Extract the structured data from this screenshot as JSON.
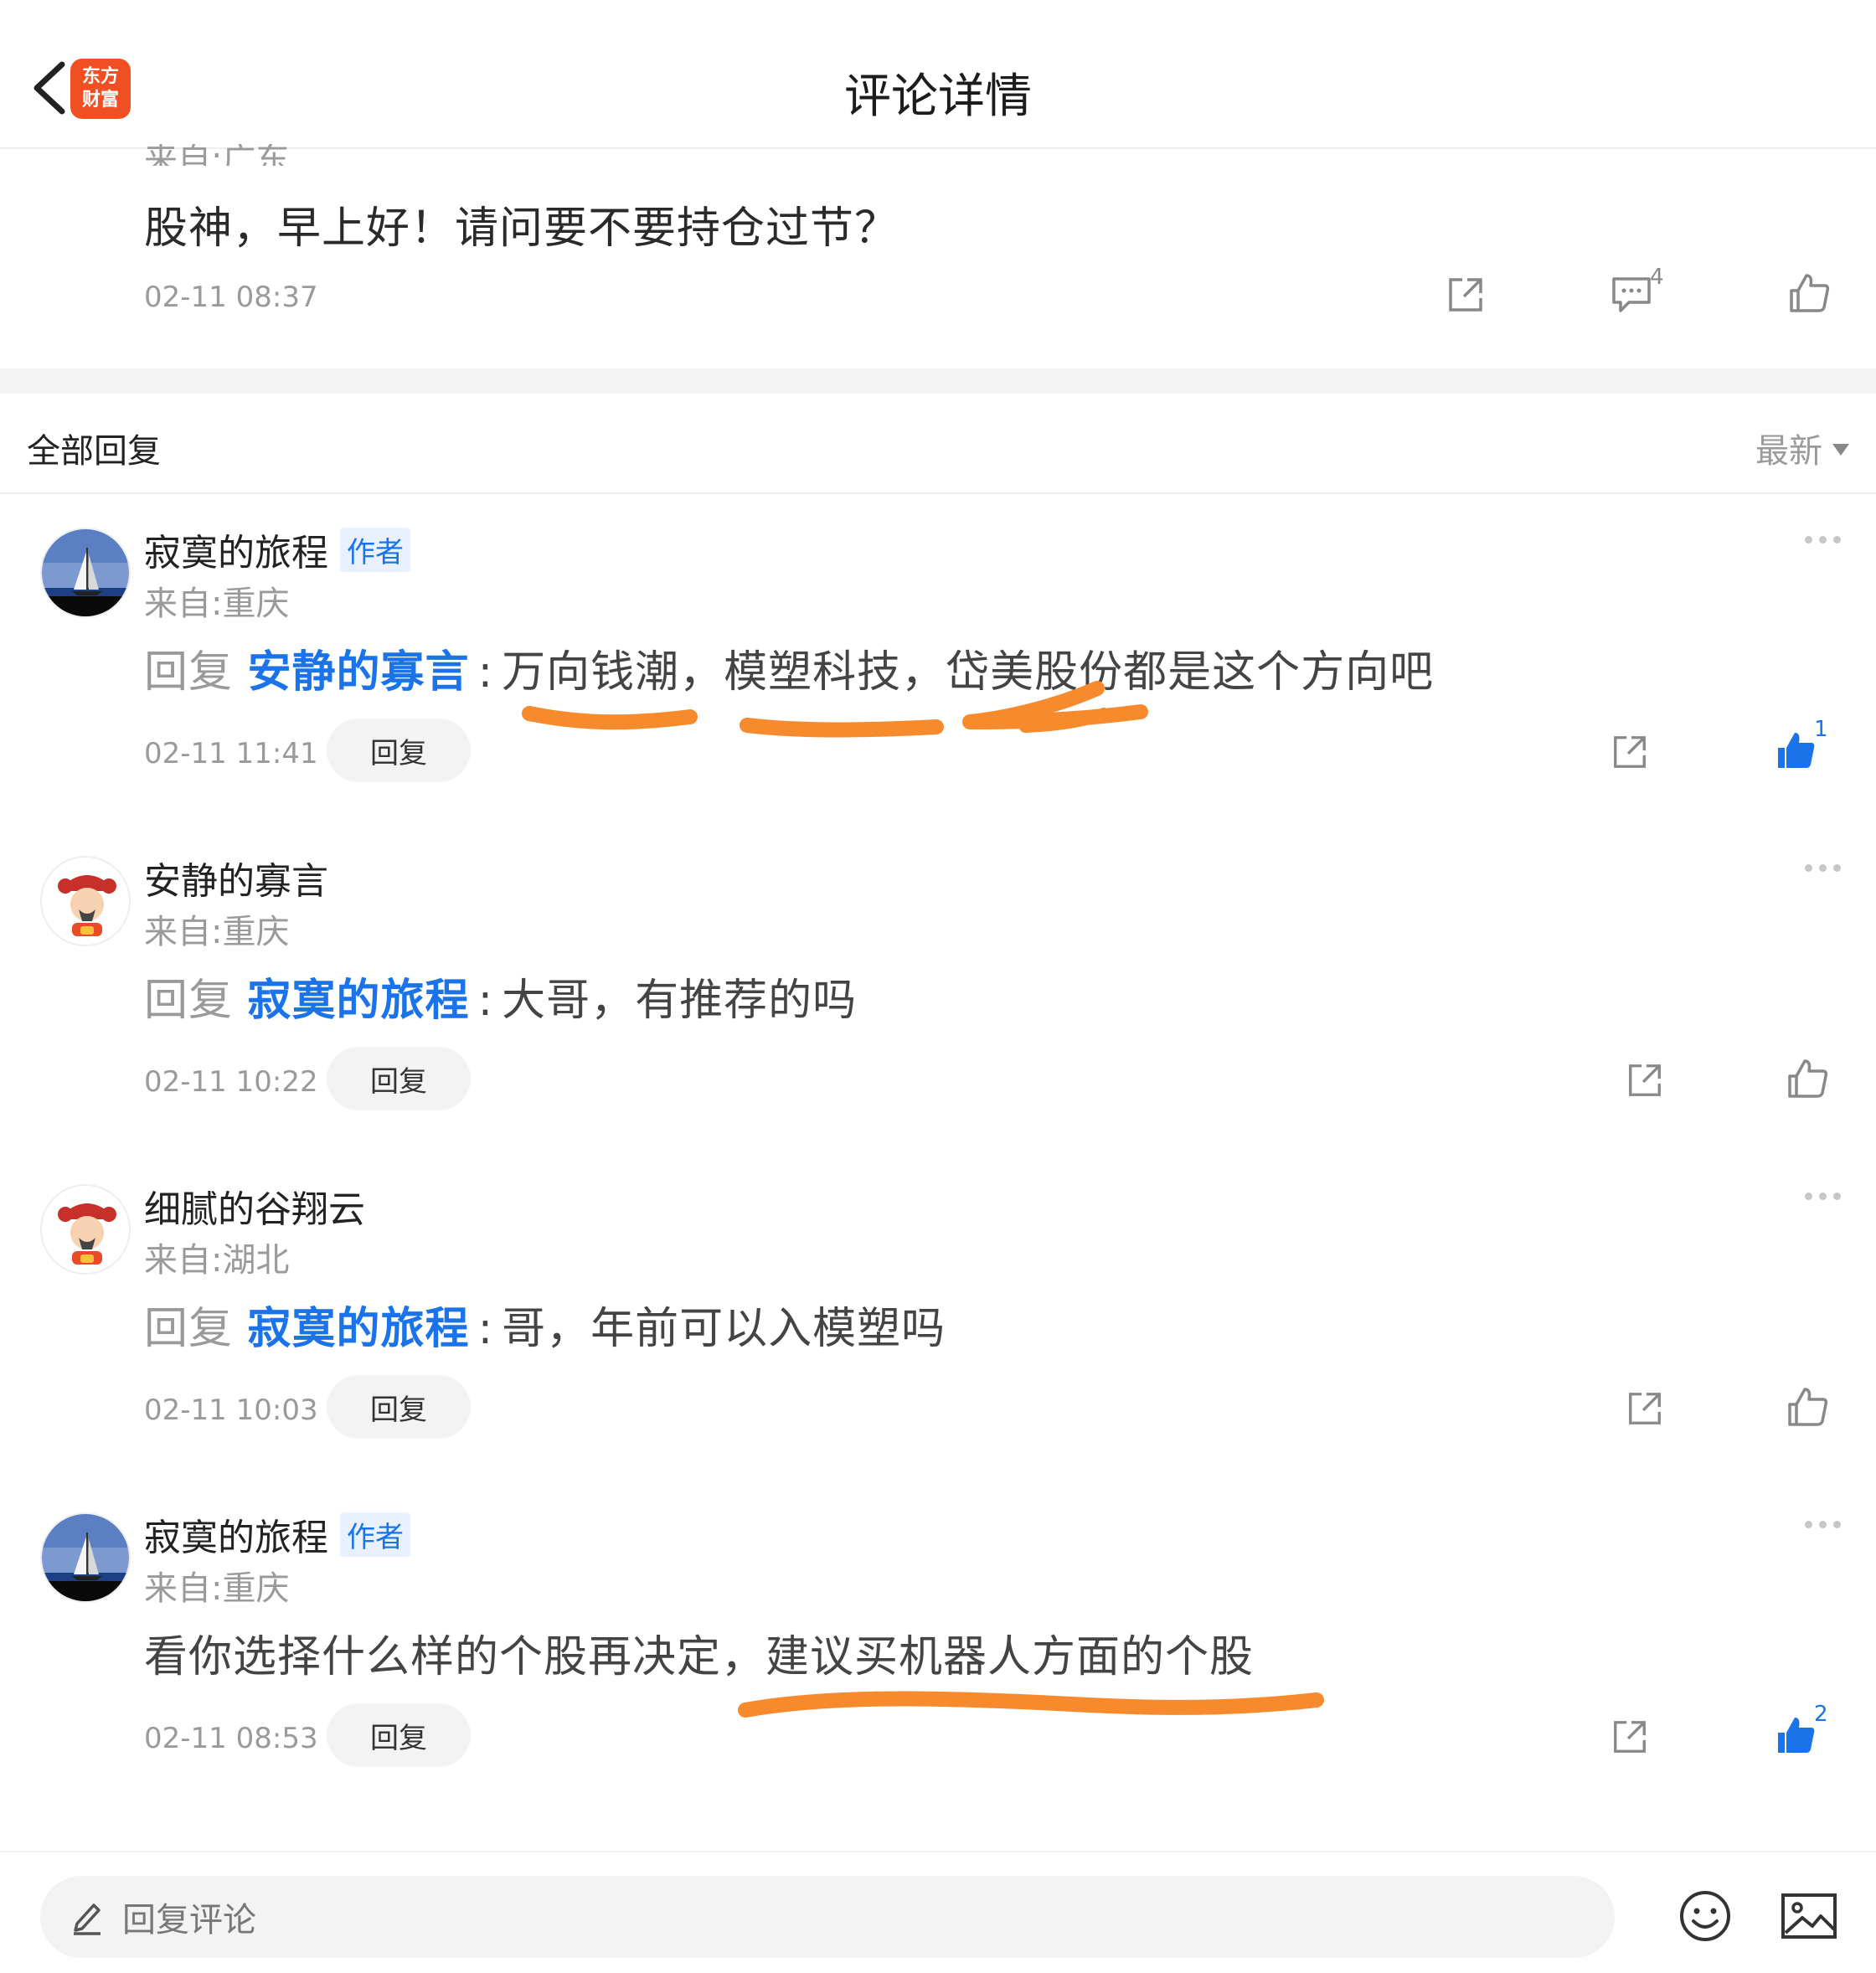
{
  "header": {
    "title": "评论详情",
    "app_logo_line1": "东方",
    "app_logo_line2": "财富"
  },
  "comment": {
    "partial_location": "来自:广东",
    "text": "股神，早上好！请问要不要持仓过节？",
    "time": "02-11 08:37",
    "comment_count": "4"
  },
  "section": {
    "title": "全部回复",
    "sort_label": "最新"
  },
  "replies": [
    {
      "username": "寂寞的旅程",
      "author_tag": "作者",
      "location": "来自:重庆",
      "reply_prefix": "回复",
      "reply_to": "安静的寡言",
      "text": "万向钱潮，模塑科技，岱美股份都是这个方向吧",
      "time": "02-11 11:41",
      "reply_button": "回复",
      "like_count": "1",
      "liked": true
    },
    {
      "username": "安静的寡言",
      "author_tag": "",
      "location": "来自:重庆",
      "reply_prefix": "回复",
      "reply_to": "寂寞的旅程",
      "text": "大哥，有推荐的吗",
      "time": "02-11 10:22",
      "reply_button": "回复",
      "like_count": "",
      "liked": false
    },
    {
      "username": "细腻的谷翔云",
      "author_tag": "",
      "location": "来自:湖北",
      "reply_prefix": "回复",
      "reply_to": "寂寞的旅程",
      "text": "哥，年前可以入模塑吗",
      "time": "02-11 10:03",
      "reply_button": "回复",
      "like_count": "",
      "liked": false
    },
    {
      "username": "寂寞的旅程",
      "author_tag": "作者",
      "location": "来自:重庆",
      "reply_prefix": "",
      "reply_to": "",
      "text": "看你选择什么样的个股再决定，建议买机器人方面的个股",
      "time": "02-11 08:53",
      "reply_button": "回复",
      "like_count": "2",
      "liked": true
    }
  ],
  "bottom_bar": {
    "input_placeholder": "回复评论"
  },
  "colors": {
    "accent_blue": "#1a73e8",
    "highlight_orange": "#f68a2c",
    "brand_red": "#f04e23"
  }
}
